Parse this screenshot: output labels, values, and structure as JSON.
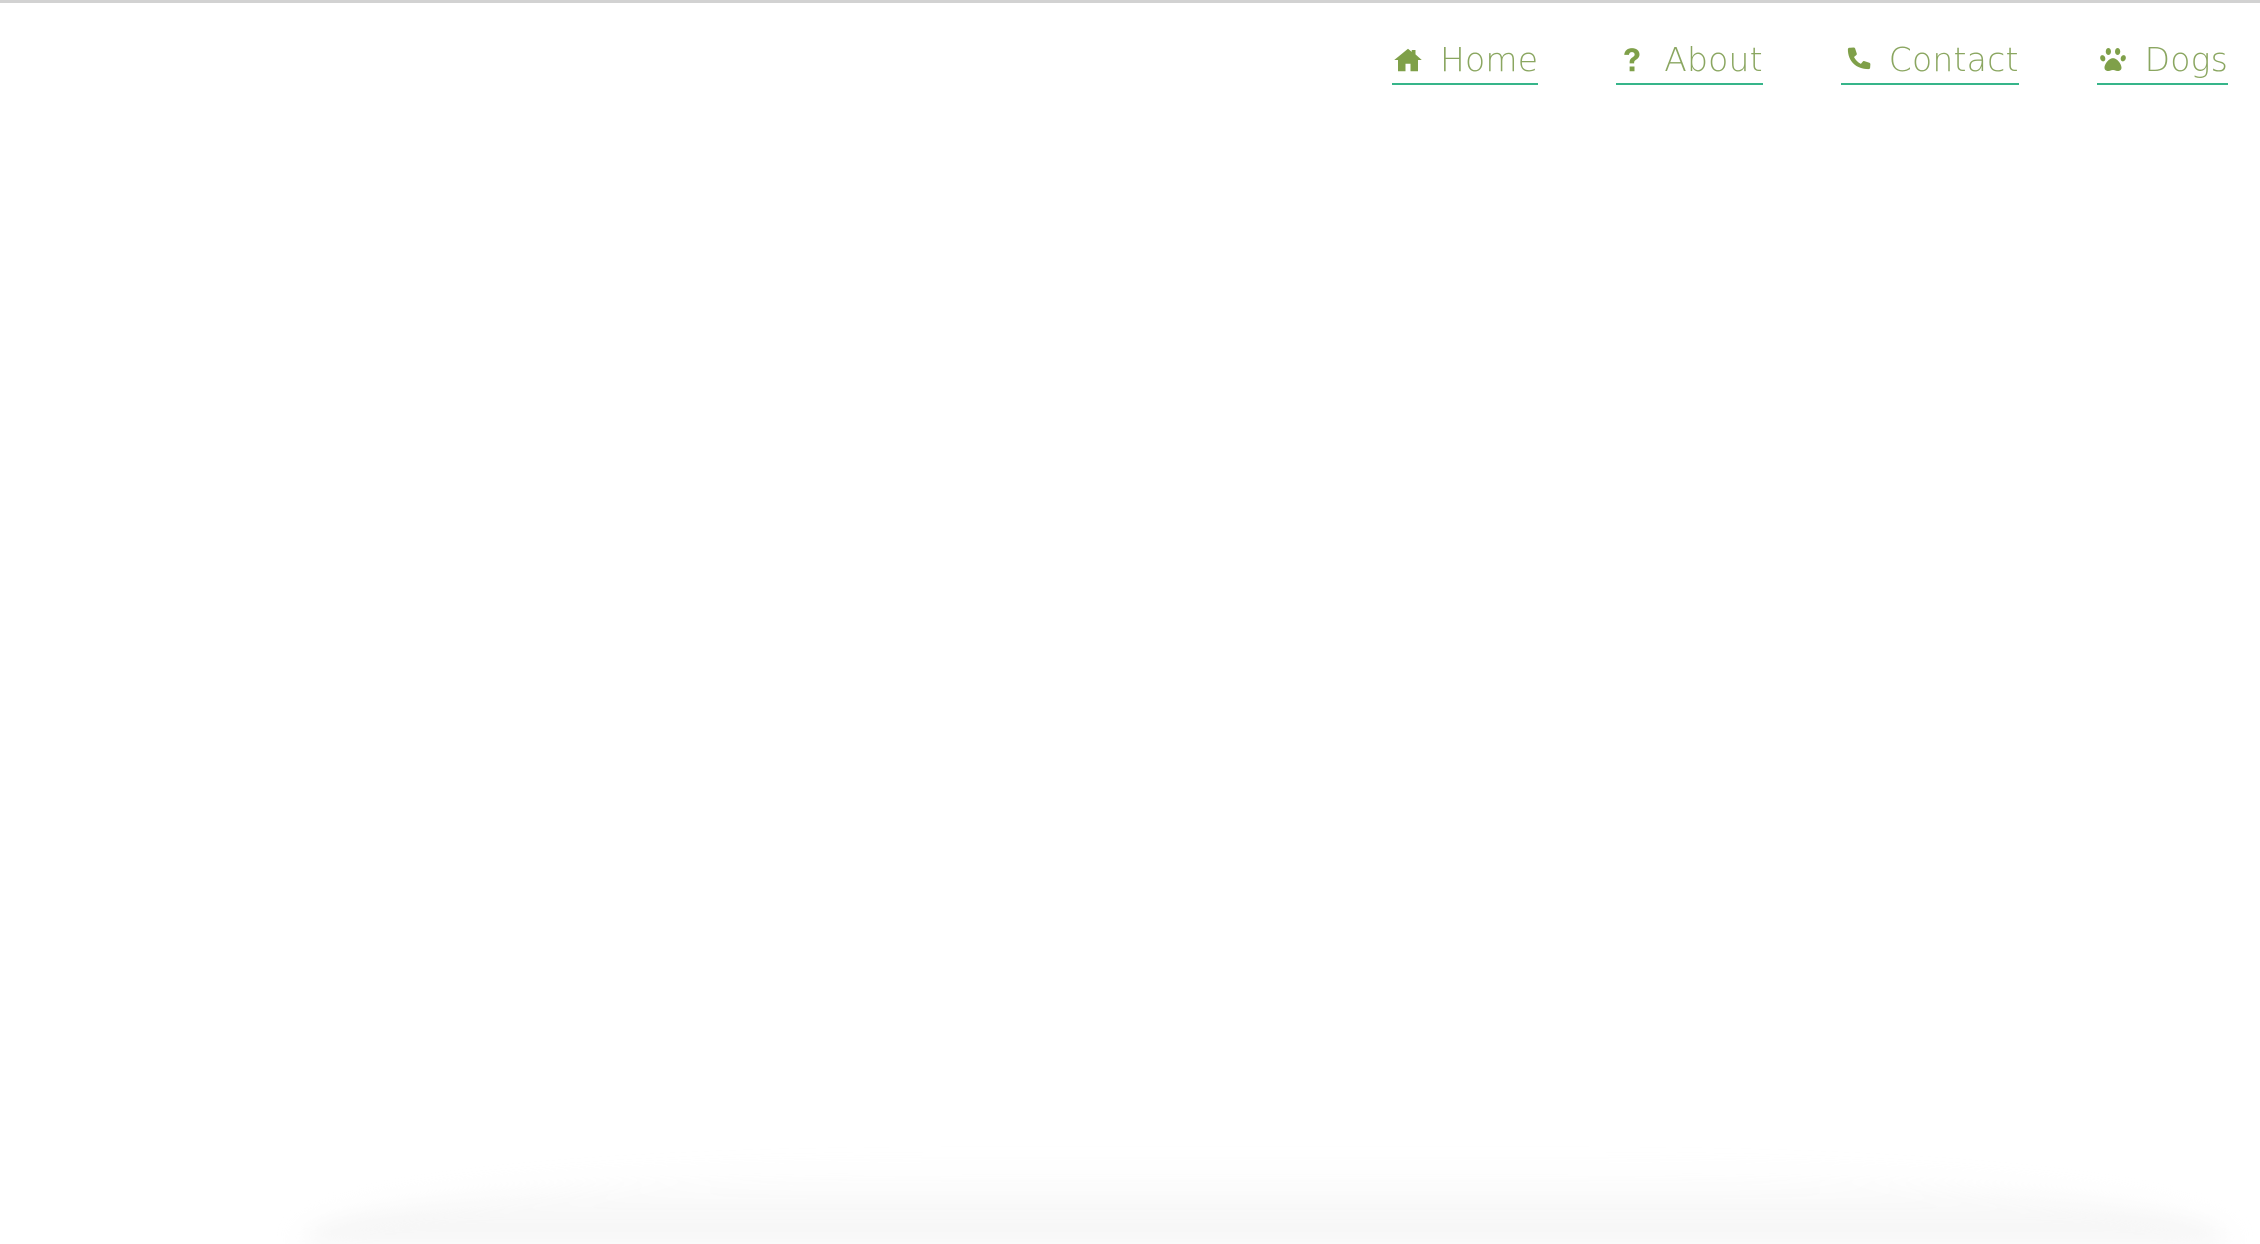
{
  "nav": {
    "items": [
      {
        "label": "Home",
        "icon": "home-icon"
      },
      {
        "label": "About",
        "icon": "question-icon"
      },
      {
        "label": "Contact",
        "icon": "phone-icon"
      },
      {
        "label": "Dogs",
        "icon": "paw-icon"
      }
    ]
  },
  "colors": {
    "link_text": "#8aa660",
    "icon": "#7fa049",
    "underline": "#36b58a",
    "top_border": "#d2d2d2",
    "background": "#ffffff"
  }
}
